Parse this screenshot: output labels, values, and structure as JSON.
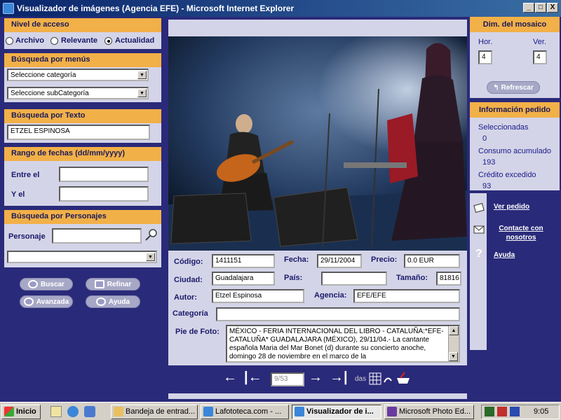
{
  "window": {
    "title": "Visualizador de imágenes (Agencia EFE) - Microsoft Internet Explorer",
    "buttons": [
      "_",
      "□",
      "X"
    ]
  },
  "access_level": {
    "heading": "Nivel de acceso",
    "options": [
      "Archivo",
      "Relevante",
      "Actualidad"
    ],
    "selected": "Actualidad"
  },
  "menu_search": {
    "heading": "Búsqueda por menús",
    "category": "Seleccione categoría",
    "subcategory": "Seleccione subCategoría"
  },
  "text_search": {
    "heading": "Búsqueda por Texto",
    "value": "ETZEL ESPINOSA"
  },
  "date_range": {
    "heading": "Rango de fechas (dd/mm/yyyy)",
    "from_label": "Entre el",
    "to_label": "Y el",
    "from": "",
    "to": ""
  },
  "people_search": {
    "heading": "Búsqueda por Personajes",
    "label": "Personaje",
    "value": "",
    "select": ""
  },
  "actions": {
    "search": "Buscar",
    "refine": "Refinar",
    "advanced": "Avanzada",
    "help": "Ayuda"
  },
  "details": {
    "code_label": "Código:",
    "code": "1411151",
    "date_label": "Fecha:",
    "date": "29/11/2004",
    "price_label": "Precio:",
    "price": "0.0  EUR",
    "city_label": "Ciudad:",
    "city": "Guadalajara",
    "country_label": "País:",
    "country": "",
    "size_label": "Tamaño:",
    "size": "81816",
    "author_label": "Autor:",
    "author": "Etzel Espinosa",
    "agency_label": "Agencia:",
    "agency": "EFE/EFE",
    "category_label": "Categoría",
    "category": "",
    "caption_label": "Pie de Foto:",
    "caption": "MÉXICO - FERIA INTERNACIONAL DEL LIBRO - CATALUÑA:*EFE-CATALUÑA* GUADALAJARA (MÉXICO), 29/11/04.- La cantante española Maria del Mar Bonet (d) durante su concierto anoche, domingo 28 de noviembre en el marco de la"
  },
  "pager": {
    "value": "9/53",
    "suffix": "das"
  },
  "mosaic": {
    "heading": "Dim. del mosaico",
    "hor_label": "Hor.",
    "ver_label": "Ver.",
    "hor": "4",
    "ver": "4",
    "refresh": "Refrescar"
  },
  "order": {
    "heading": "Información pedido",
    "selected_label": "Seleccionadas",
    "selected": "0",
    "consumption_label": "Consumo acumulado",
    "consumption": "193",
    "credit_label": "Crédito excedido",
    "credit": "93"
  },
  "links": {
    "view_order": "Ver pedido",
    "contact": "Contacte con nosotros",
    "help": "Ayuda"
  },
  "taskbar": {
    "start": "Inicio",
    "tasks": [
      "Bandeja de entrad...",
      "Lafototeca.com - ...",
      "Visualizador de i...",
      "Microsoft Photo Ed..."
    ],
    "clock": "9:05"
  }
}
